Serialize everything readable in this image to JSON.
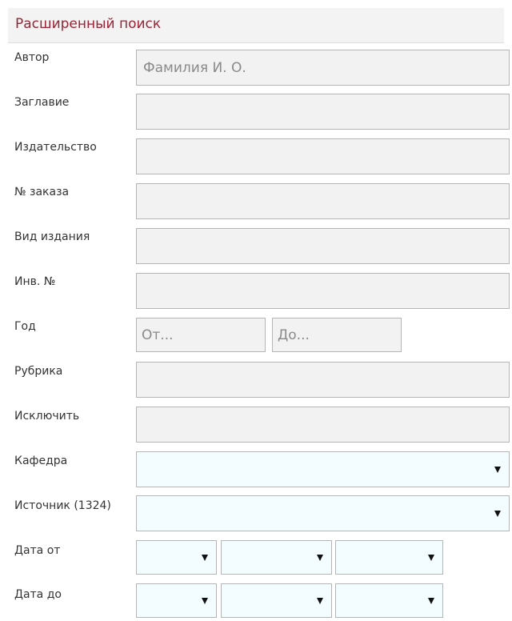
{
  "header": {
    "title": "Расширенный поиск"
  },
  "fields": {
    "author": {
      "label": "Автор",
      "placeholder": "Фамилия И. О.",
      "value": ""
    },
    "title": {
      "label": "Заглавие",
      "value": ""
    },
    "publisher": {
      "label": "Издательство",
      "value": ""
    },
    "order_number": {
      "label": "№ заказа",
      "value": ""
    },
    "publication_type": {
      "label": "Вид издания",
      "value": ""
    },
    "inventory_number": {
      "label": "Инв. №",
      "value": ""
    },
    "year": {
      "label": "Год",
      "from_placeholder": "От...",
      "to_placeholder": "До..."
    },
    "rubric": {
      "label": "Рубрика",
      "value": ""
    },
    "exclude": {
      "label": "Исключить",
      "value": ""
    },
    "department": {
      "label": "Кафедра",
      "selected": ""
    },
    "source": {
      "label": "Источник (1324)",
      "selected": ""
    },
    "date_from": {
      "label": "Дата от",
      "day": "",
      "month": "",
      "year": ""
    },
    "date_to": {
      "label": "Дата до",
      "day": "",
      "month": "",
      "year": ""
    }
  },
  "icons": {
    "dropdown": "triangle-down-icon"
  },
  "colors": {
    "title_text": "#9b2335",
    "header_bg": "#f3f3f3",
    "input_bg": "#f2f2f2",
    "select_bg": "#f3fcff",
    "border": "#b5b5b5"
  }
}
